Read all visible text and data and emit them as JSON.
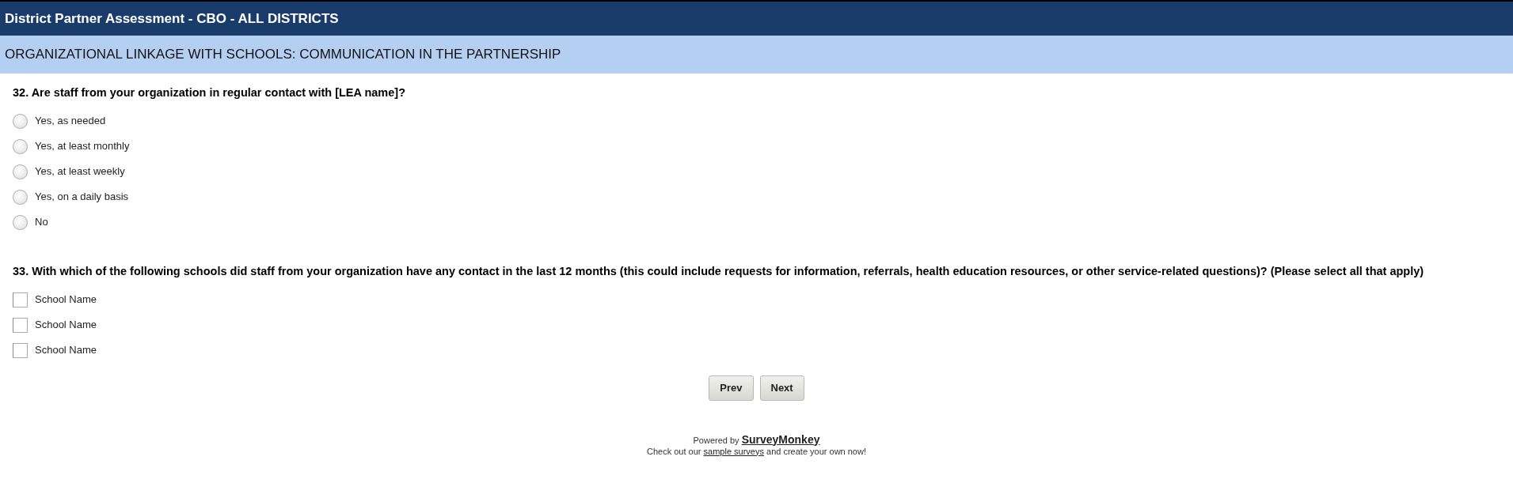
{
  "survey_title": "District Partner Assessment - CBO - ALL DISTRICTS",
  "section_title": "ORGANIZATIONAL LINKAGE WITH SCHOOLS: COMMUNICATION IN THE PARTNERSHIP",
  "questions": [
    {
      "kind": "radio",
      "text": "32. Are staff from your organization in regular contact with [LEA name]?",
      "options": [
        {
          "label": "Yes, as needed",
          "selected": false
        },
        {
          "label": "Yes, at least monthly",
          "selected": false
        },
        {
          "label": "Yes, at least weekly",
          "selected": false
        },
        {
          "label": "Yes, on a daily basis",
          "selected": false
        },
        {
          "label": "No",
          "selected": false
        }
      ]
    },
    {
      "kind": "checkbox",
      "text": "33. With which of the following schools did staff from your organization have any contact in the last 12 months (this could include requests for information, referrals, health education resources, or other service-related questions)? (Please select all that apply)",
      "options": [
        {
          "label": "School Name",
          "checked": false
        },
        {
          "label": "School Name",
          "checked": false
        },
        {
          "label": "School Name",
          "checked": false
        }
      ]
    }
  ],
  "buttons": [
    "Prev",
    "Next"
  ],
  "footer": {
    "powered_by": "Powered by",
    "brand_link": "SurveyMonkey",
    "line_before": "Check out our",
    "link": "sample surveys",
    "line_after": "and create your own now!"
  }
}
